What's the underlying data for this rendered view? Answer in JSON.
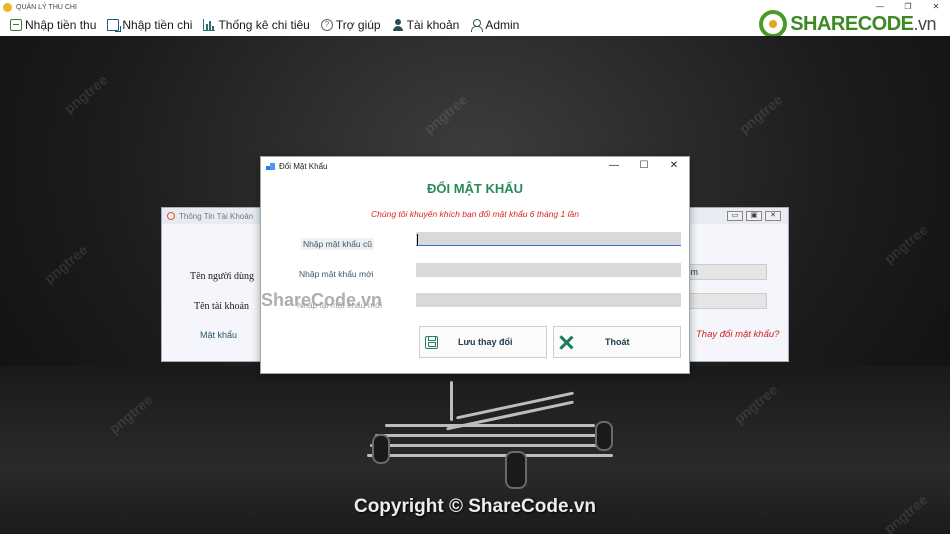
{
  "app": {
    "title": "QUẢN LÝ THU CHI",
    "window_controls": [
      "—",
      "❐",
      "✕"
    ]
  },
  "menu": {
    "items": [
      {
        "label": "Nhập tiền thu",
        "icon": "income-entry-icon"
      },
      {
        "label": "Nhập tiền chi",
        "icon": "expense-entry-icon"
      },
      {
        "label": "Thống kê chi tiêu",
        "icon": "statistics-chart-icon"
      },
      {
        "label": "Trợ giúp",
        "icon": "help-icon"
      },
      {
        "label": "Tài khoản",
        "icon": "user-icon"
      },
      {
        "label": "Admin",
        "icon": "admin-icon"
      }
    ]
  },
  "logo": {
    "brand": "SHARECODE",
    "domain": ".vn"
  },
  "background_watermark": "pngtree",
  "info_window": {
    "title": "Thông Tin Tài Khoản",
    "labels": {
      "user_name": "Tên người dùng",
      "account_name": "Tên tài khoản",
      "password": "Mật khẩu"
    },
    "email_partial": "com",
    "change_password_link": "Thay đổi mật khẩu?",
    "window_controls": [
      "▭",
      "▣",
      "✕"
    ]
  },
  "dialog": {
    "title": "Đổi Mật Khẩu",
    "heading": "ĐỔI MẬT KHẨU",
    "note": "Chúng tôi khuyến khích bạn đổi mật khẩu 6 tháng 1 lần",
    "fields": {
      "old_password": {
        "label": "Nhập mật khẩu cũ",
        "value": ""
      },
      "new_password": {
        "label": "Nhập mật khẩu mới",
        "value": ""
      },
      "confirm_password": {
        "label": "Nhập lại mật khẩu mới",
        "value": ""
      }
    },
    "buttons": {
      "save": "Lưu thay đổi",
      "exit": "Thoát"
    },
    "window_controls": [
      "—",
      "☐",
      "✕"
    ]
  },
  "overlay": {
    "sharecode_watermark": "ShareCode.vn",
    "copyright": "Copyright © ShareCode.vn"
  }
}
